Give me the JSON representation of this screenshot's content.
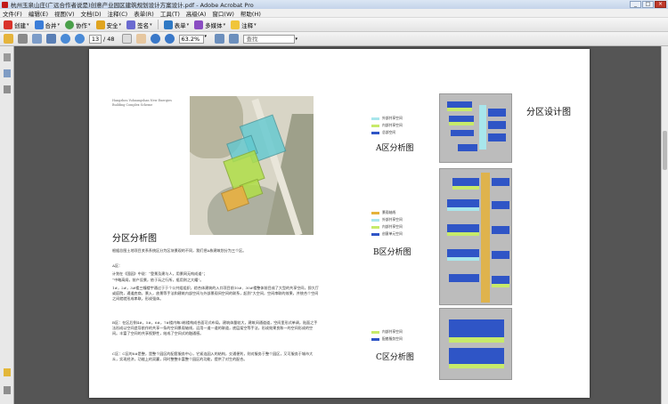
{
  "window": {
    "title": "杭州玉泉山庄(广远合作者说是)创意产业园区建筑规划设计方案设计.pdf - Adobe Acrobat Pro",
    "controls": [
      "_",
      "□",
      "×"
    ]
  },
  "menu": [
    "文件(F)",
    "编辑(E)",
    "视图(V)",
    "文档(D)",
    "注释(C)",
    "表单(R)",
    "工具(T)",
    "高级(A)",
    "窗口(W)",
    "帮助(H)"
  ],
  "toolbar": {
    "create": "创建",
    "combine": "合并",
    "collaborate": "协作",
    "secure": "安全",
    "sign": "签名",
    "forms": "表单",
    "multimedia": "多媒体",
    "comment": "注释"
  },
  "nav": {
    "page_current": "13",
    "page_total": "/ 48",
    "zoom": "63.2%",
    "find_placeholder": "查找"
  },
  "document": {
    "caption_small": "Hangzhou Yuhuangshan New Energies Building Complex Scheme",
    "main_title": "分区分析图",
    "paragraphs": [
      "根据总图土地项目关系系统区分为区块景观的不同，我们把A栋建筑划分为三个区。",
      "A区：",
      "计划在《国园》中说：“登景及建与人，用景网无构成道”；",
      "“中略高阁，前户设景，依于玩之行所，瓶用则之大耀”。",
      "1#，2#，3#楼三幢楼宇通过于于个公共组组织，综合体建筑的入口项目前10#、30#楼整体前目成了大型的共享空间，即大厅或庭院，通道底商，景入，放景等手法和建筑内部空间与外部景观间空间的联系，起到“大空间，空间串联的效果，并统合个空间之间就就形成串联，形成强体。",
      "B区：在区后侧4#，5#，6#，7#楼内每3栋楼构成合面可式布局，建筑体量较大，建筑间通道道，空间里形式单调，贴面之手法形成以空间造导航作的共享一条的空间景观轴线，运用一道一道的联道，底层架空等手法，形成效果良和一的空间形成的空间。丰富了空间的共享视野性，结成了空间式的融通感。",
      "C区：C区的8#是整，是整个园区的配套服务中心，它紧连园入的结构，交通便利，则对服务于整个园区，又可服务于城市大众，实现经济，功能上的双赢，同时整整丰富整个园区的功能，提供了对生的配合。"
    ],
    "right_title": "分区设计图",
    "zone_a": {
      "title": "A区分析图",
      "legend": [
        {
          "label": "外部共享空间",
          "color": "#a8e6ec"
        },
        {
          "label": "内部共享空间",
          "color": "#c7ea6a"
        },
        {
          "label": "总部空间",
          "color": "#2f55c6"
        }
      ]
    },
    "zone_b": {
      "title": "B区分析图",
      "legend": [
        {
          "label": "景观轴线",
          "color": "#e5b23a"
        },
        {
          "label": "外部共享空间",
          "color": "#a8e6ec"
        },
        {
          "label": "内部共享空间",
          "color": "#c7ea6a"
        },
        {
          "label": "创意单元空间",
          "color": "#2f55c6"
        }
      ]
    },
    "zone_c": {
      "title": "C区分析图",
      "legend": [
        {
          "label": "内部共享空间",
          "color": "#c7ea6a"
        },
        {
          "label": "配套服务空间",
          "color": "#2f55c6"
        }
      ]
    }
  }
}
